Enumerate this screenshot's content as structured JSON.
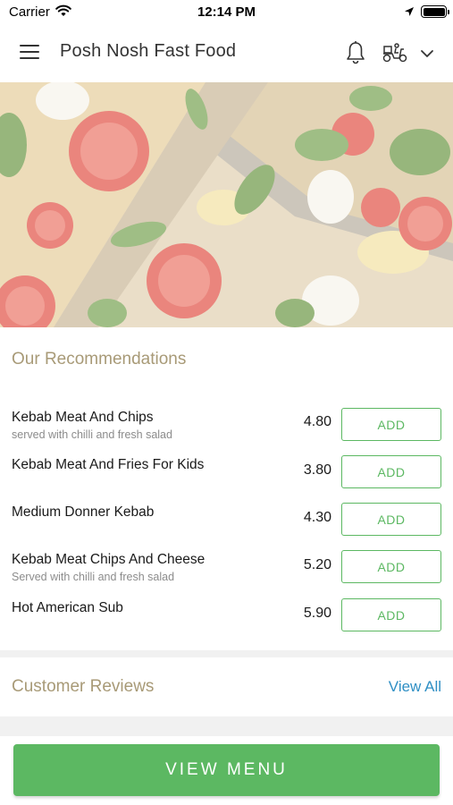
{
  "status_bar": {
    "carrier": "Carrier",
    "time": "12:14 PM"
  },
  "header": {
    "title": "Posh Nosh Fast Food",
    "icons": [
      "menu-icon",
      "bell-icon",
      "scooter-icon",
      "chevron-down-icon"
    ]
  },
  "hero": {
    "image": "pizza with tomatoes, basil and mozzarella"
  },
  "recommendations": {
    "title": "Our Recommendations",
    "items": [
      {
        "name": "Kebab Meat And Chips",
        "description": "served with chilli and fresh salad",
        "price": "4.80",
        "button": "ADD"
      },
      {
        "name": "Kebab Meat And Fries For Kids",
        "description": "",
        "price": "3.80",
        "button": "ADD"
      },
      {
        "name": "Medium Donner Kebab",
        "description": "",
        "price": "4.30",
        "button": "ADD"
      },
      {
        "name": "Kebab Meat Chips And Cheese",
        "description": "Served with chilli and fresh salad",
        "price": "5.20",
        "button": "ADD"
      },
      {
        "name": "Hot American Sub",
        "description": "",
        "price": "5.90",
        "button": "ADD"
      }
    ]
  },
  "reviews": {
    "title": "Customer Reviews",
    "view_all": "View All"
  },
  "footer": {
    "view_menu": "VIEW MENU"
  },
  "colors": {
    "accent_green": "#5cb862",
    "section_title": "#a89a77",
    "link_blue": "#2f8fc4"
  }
}
